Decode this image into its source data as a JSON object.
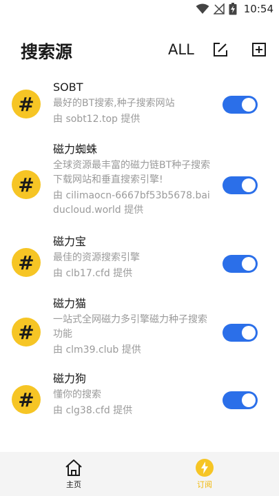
{
  "status_bar": {
    "time": "10:54"
  },
  "header": {
    "title": "搜索源",
    "all_label": "ALL"
  },
  "colors": {
    "accent_yellow": "#f6c525",
    "toggle_blue": "#2b6fe9"
  },
  "sources": [
    {
      "badge": "#",
      "title": "SOBT",
      "description": "最好的BT搜索,种子搜索网站",
      "provider": "由 sobt12.top 提供",
      "enabled": true
    },
    {
      "badge": "#",
      "title": "磁力蜘蛛",
      "description": "全球资源最丰富的磁力链BT种子搜索下载网站和垂直搜索引擎!",
      "provider": "由 cilimaocn-6667bf53b5678.baiducloud.world 提供",
      "enabled": true
    },
    {
      "badge": "#",
      "title": "磁力宝",
      "description": "最佳的资源搜索引擎",
      "provider": "由 clb17.cfd 提供",
      "enabled": true
    },
    {
      "badge": "#",
      "title": "磁力猫",
      "description": "一站式全网磁力多引擎磁力种子搜索功能",
      "provider": "由 clm39.club 提供",
      "enabled": true
    },
    {
      "badge": "#",
      "title": "磁力狗",
      "description": "懂你的搜索",
      "provider": "由 clg38.cfd 提供",
      "enabled": true
    }
  ],
  "bottom_nav": {
    "home": {
      "label": "主页",
      "icon": "home-icon"
    },
    "subscribe": {
      "label": "订阅",
      "icon": "lightning-icon",
      "active": true
    }
  }
}
